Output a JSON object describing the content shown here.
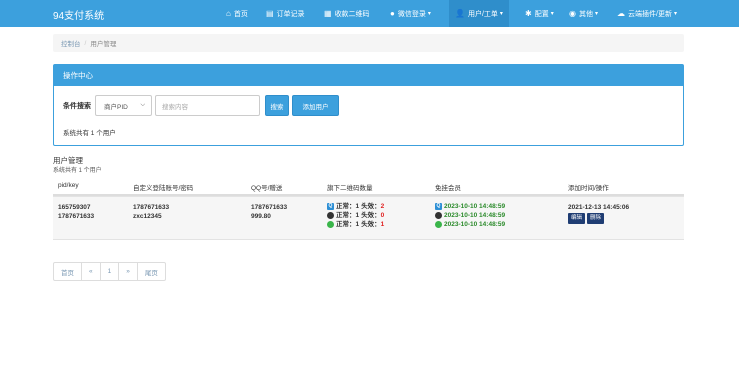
{
  "brand": "94支付系统",
  "nav": {
    "home": "首页",
    "orders": "订单记录",
    "qrcode": "收款二维码",
    "wechat": "微信登录",
    "users": "用户/工单",
    "config": "配置",
    "other": "其他",
    "cloud": "云端插件/更新"
  },
  "breadcrumb": {
    "home": "控制台",
    "separator": "/",
    "current": "用户管理"
  },
  "panel": {
    "title": "操作中心",
    "search_label": "条件搜索",
    "select_value": "商户PID",
    "search_placeholder": "搜索内容",
    "search_button": "搜索",
    "add_button": "添加用户",
    "count_text": "系统共有 1 个用户"
  },
  "section": {
    "title": "用户管理",
    "subtitle": "系统共有 1 个用户"
  },
  "table": {
    "headers": [
      "pid/key",
      "自定义登陆账号/密码",
      "QQ号/赠送",
      "旗下二维码数量",
      "免挂会员",
      "添加时间/操作"
    ],
    "row": {
      "pid": "165759307",
      "key": "1787671633",
      "account": "1787671633",
      "password": "zxc12345",
      "qq": "1787671633",
      "gift": "999.80",
      "qr_lines": [
        {
          "icon": "qq-icon",
          "label": "正常：",
          "normal": "1",
          "fail_label": "头效：",
          "fail": "2"
        },
        {
          "icon": "dingtalk-icon",
          "label": "正常：",
          "normal": "1",
          "fail_label": "头效：",
          "fail": "0"
        },
        {
          "icon": "wechat-icon",
          "label": "正常：",
          "normal": "1",
          "fail_label": "头效：",
          "fail": "1"
        }
      ],
      "vip_dates": [
        "2023-10-10 14:48:59",
        "2023-10-10 14:48:59",
        "2023-10-10 14:48:59"
      ],
      "added_time": "2021-12-13 14:45:06",
      "actions": [
        "编辑",
        "删除"
      ]
    }
  },
  "pagination": {
    "first": "首页",
    "prev": "«",
    "current": "1",
    "next": "»",
    "last": "尾页"
  }
}
